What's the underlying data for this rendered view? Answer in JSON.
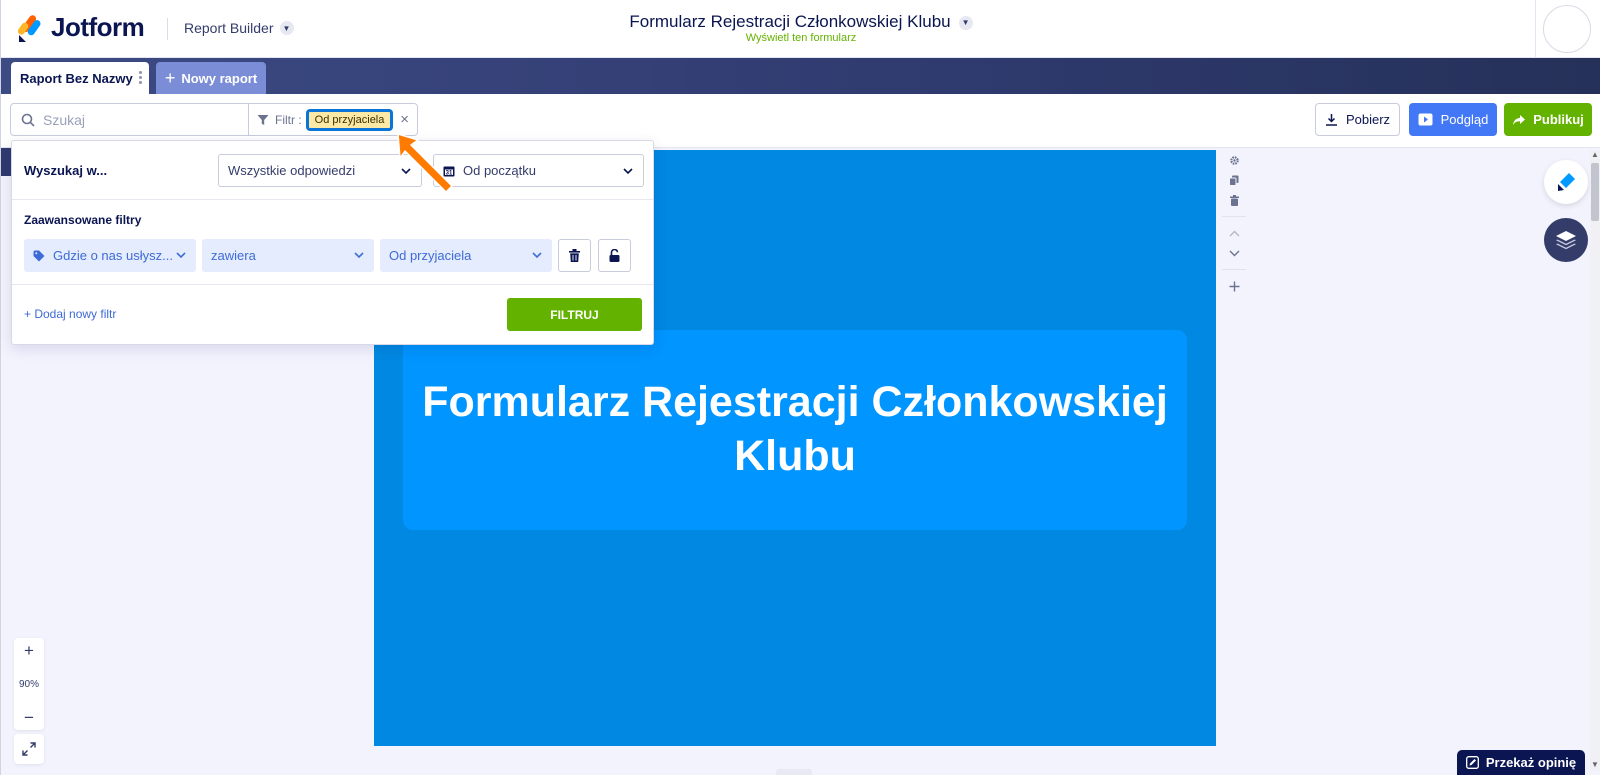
{
  "header": {
    "brand": "Jotform",
    "app_name": "Report Builder",
    "form_title": "Formularz Rejestracji Członkowskiej Klubu",
    "view_form": "Wyświetl ten formularz"
  },
  "tabs": {
    "active": "Raport Bez Nazwy",
    "new": "Nowy raport"
  },
  "toolbar": {
    "search_placeholder": "Szukaj",
    "filter_label": "Filtr :",
    "filter_chip": "Od przyjaciela",
    "clear": "×",
    "download": "Pobierz",
    "preview": "Podgląd",
    "publish": "Publikuj"
  },
  "filter_panel": {
    "search_in_label": "Wyszukaj w...",
    "responses_select": "Wszystkie odpowiedzi",
    "date_select": "Od początku",
    "advanced_title": "Zaawansowane filtry",
    "field_select": "Gdzie o nas usłysz...",
    "operator_select": "zawiera",
    "value_select": "Od przyjaciela",
    "add_filter": "+ Dodaj nowy filtr",
    "filter_button": "FILTRUJ"
  },
  "canvas": {
    "hero_title": "Formularz Rejestracji Członkowskiej Klubu"
  },
  "zoom": {
    "plus": "+",
    "level": "90%",
    "minus": "−"
  },
  "feedback": "Przekaż opinię",
  "colors": {
    "brand_navy": "#0a1551",
    "publish_green": "#64b200",
    "preview_blue": "#4277f5",
    "page_blue": "#0088e2",
    "hero_blue": "#0095ff",
    "chip_yellow": "#fde9a6",
    "annotation_orange": "#ff7a00"
  }
}
